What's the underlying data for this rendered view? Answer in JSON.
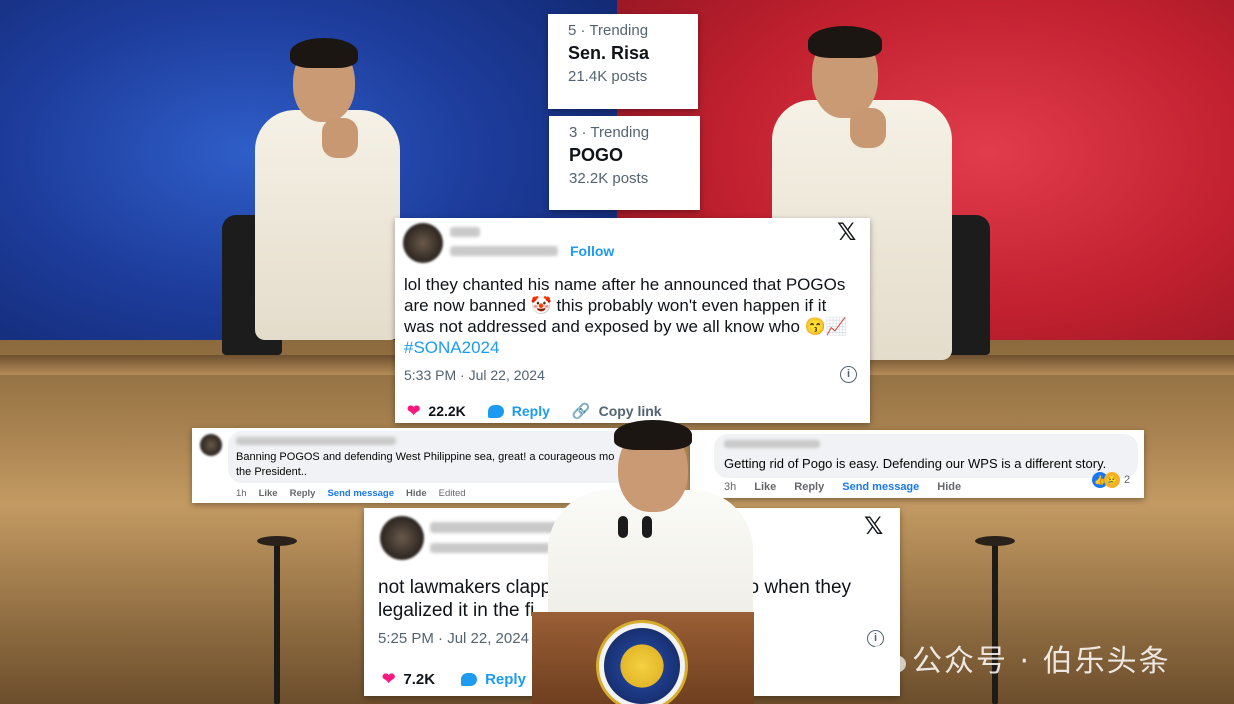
{
  "trending": [
    {
      "meta": "5 · Trending",
      "topic": "Sen. Risa",
      "count": "21.4K posts"
    },
    {
      "meta": "3 · Trending",
      "topic": "POGO",
      "count": "32.2K posts"
    }
  ],
  "tweet_main": {
    "follow_label": "Follow",
    "text_line1": "lol they chanted his name after he announced that POGOs",
    "text_line2": "are now banned 🤡 this probably won't even happen if it",
    "text_line3": "was not addressed and exposed by we all know who 😙📈",
    "hashtag": "#SONA2024",
    "timestamp": "5:33 PM · Jul 22, 2024",
    "likes": "22.2K",
    "reply_label": "Reply",
    "copy_link_label": "Copy link"
  },
  "fb_comment_left": {
    "text_line1": "Banning POGOS and defending West Philippine sea, great! a courageous mo",
    "text_line2": "the President..",
    "time": "1h",
    "like_label": "Like",
    "reply_label": "Reply",
    "send_label": "Send message",
    "hide_label": "Hide",
    "edited_label": "Edited"
  },
  "fb_comment_right": {
    "text": "Getting rid of Pogo is easy. Defending our WPS is a different story.",
    "time": "3h",
    "like_label": "Like",
    "reply_label": "Reply",
    "send_label": "Send message",
    "hide_label": "Hide",
    "reaction_count": "2"
  },
  "tweet_bottom": {
    "text_line1a": "not lawmakers clappi",
    "text_line1b": "ogo when they",
    "text_line2": "legalized it in the fi",
    "timestamp": "5:25 PM · Jul 22, 2024",
    "likes": "7.2K",
    "reply_label": "Reply"
  },
  "watermark": "公众号 · 伯乐头条",
  "colors": {
    "blue_bg": "#1d3c9b",
    "red_bg": "#c1202f",
    "twitter_blue": "#1d9bf0",
    "heart_pink": "#f91880",
    "fb_blue": "#1877f2"
  }
}
